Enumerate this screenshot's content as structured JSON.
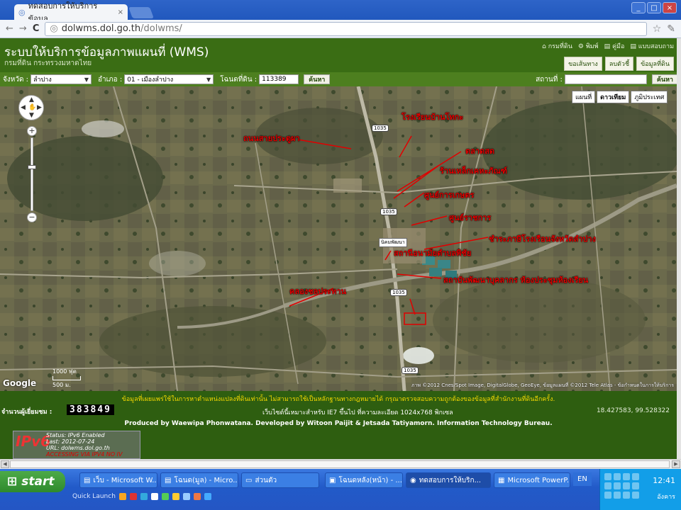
{
  "browser": {
    "tab_title": "ทดสอบการให้บริการข้อมูล",
    "tab_close": "×",
    "url_host": "dolwms.dol.go.th",
    "url_path": "/dolwms/",
    "window_buttons": [
      "_",
      "□",
      "×"
    ]
  },
  "header": {
    "title": "ระบบให้บริการข้อมูลภาพแผนที่ (WMS)",
    "subtitle": "กรมที่ดิน กระทรวงมหาดไทย",
    "links": [
      "⌂ กรมที่ดิน",
      "⚙ พิมพ์",
      "▤ คู่มือ",
      "▤ แบบสอบถาม"
    ],
    "buttons": [
      "ขอเส้นทาง",
      "ลบตัวชี้",
      "ข้อมูลที่ดิน"
    ]
  },
  "search": {
    "province_label": "จังหวัด :",
    "province_value": "ลำปาง",
    "district_label": "อำเภอ :",
    "district_value": "01 - เมืองลำปาง",
    "deed_label": "โฉนดที่ดิน :",
    "deed_value": "113389",
    "search_button": "ค้นหา",
    "place_label": "สถานที่ :",
    "place_value": "",
    "place_button": "ค้นหา"
  },
  "map": {
    "map_types": [
      "แผนที่",
      "ดาวเทียม",
      "ภูมิประเทศ"
    ],
    "active_type": "ดาวเทียม",
    "labels": [
      {
        "text": "โรงเรียนบ้านโทกะ"
      },
      {
        "text": "ถนนสายประตูผา"
      },
      {
        "text": "ตลาดสด"
      },
      {
        "text": "ร้านเหล็กเคหะภัณฑ์"
      },
      {
        "text": "ศูนย์การเกษตร"
      },
      {
        "text": "ศูนย์ราชการ"
      },
      {
        "text": "ชำระภาษีโรงเรือนจังหวัดลำปาง"
      },
      {
        "text": "สถานีอนามัยตำบลพิชัย"
      },
      {
        "text": "สถาบันพัฒนาบุคลากร ห้องประชุมห้องเรียน"
      },
      {
        "text": "คลองชลประทาน"
      }
    ],
    "route_shields": [
      "1035",
      "1035",
      "1035",
      "1035"
    ],
    "village_label": "นิคมพัฒนา",
    "zoom_in": "+",
    "zoom_out": "−",
    "google_logo": "Google",
    "scale_top": "1000 ฟุต",
    "scale_bottom": "500 ม.",
    "attribution": "ภาพ ©2012 Cnes/Spot Image, DigitalGlobe, GeoEye, ข้อมูลแผนที่ ©2012 Tele Atlas - ข้อกำหนดในการให้บริการ"
  },
  "footer": {
    "disclaimer": "ข้อมูลที่เผยแพร่ใช้ในการหาตำแหน่งแปลงที่ดินเท่านั้น ไม่สามารถใช้เป็นหลักฐานทางกฎหมายได้ กรุณาตรวจสอบความถูกต้องของข้อมูลที่สำนักงานที่ดินอีกครั้ง.",
    "counter_label": "จำนวนผู้เยี่ยมชม :",
    "counter_value": "383849",
    "browser_note": "เว็บไซต์นี้เหมาะสำหรับ IE7 ขึ้นไป ที่ความละเอียด 1024x768 พิกเซล",
    "coords": "18.427583, 99.528322",
    "credits": "Produced by Waewipa Phonwatana.  Developed by Witoon Paijit & Jetsada Tatiyamorn. Information Technology Bureau.",
    "ipv6_status": "Status: IPv6 Enabled",
    "ipv6_last": "Last: 2012-07-24",
    "ipv6_url": "URL: dolwms.dol.go.th",
    "ipv6_warn": "ACCESSING VIA IPV4 NO IV"
  },
  "taskbar": {
    "start": "start",
    "items": [
      {
        "label": "เว็บ - Microsoft W..."
      },
      {
        "label": "โฉนด(มูล) - Micro..."
      },
      {
        "label": "ส่วนตัว"
      },
      {
        "label": "โฉนดหลัง(หน้า) - ..."
      },
      {
        "label": "ทดสอบการให้บริก..."
      },
      {
        "label": "Microsoft PowerP..."
      }
    ],
    "quick_launch": "Quick Launch",
    "lang": "EN",
    "time": "12:41",
    "day": "อังคาร"
  }
}
